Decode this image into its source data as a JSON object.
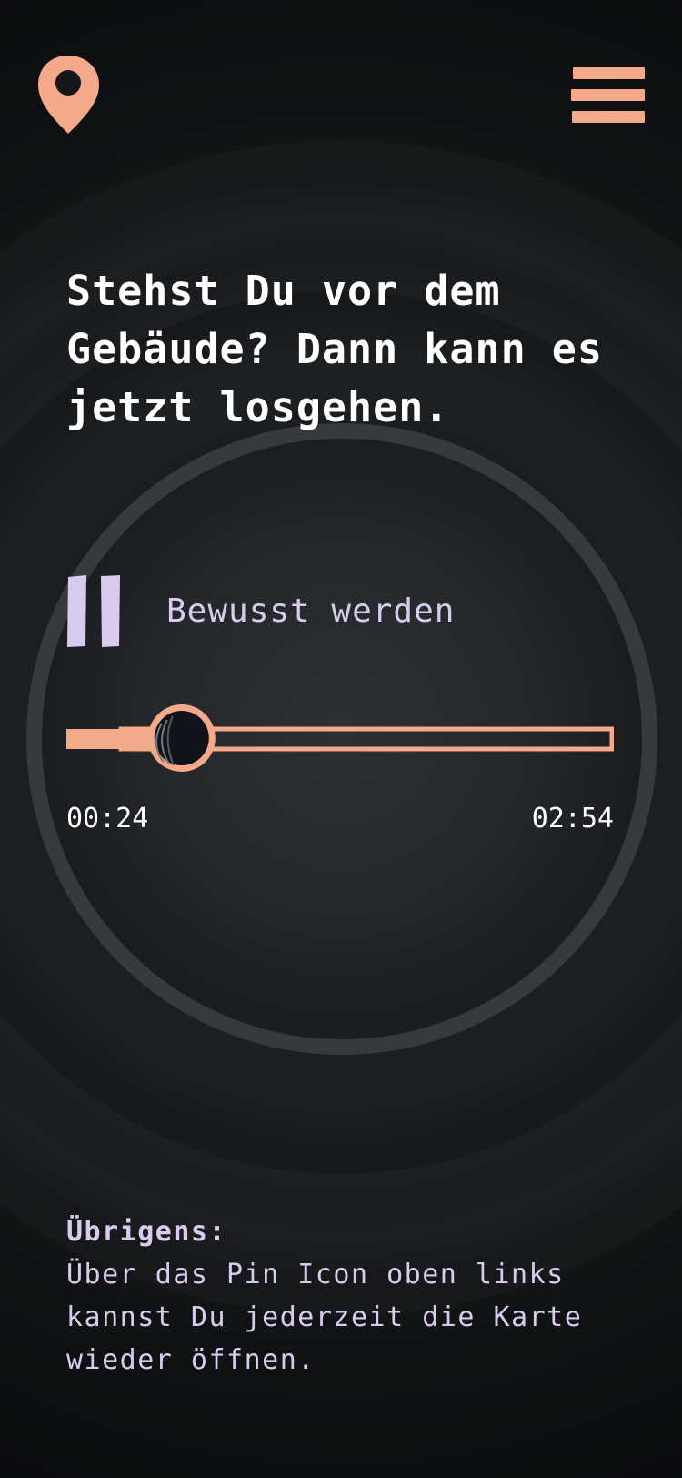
{
  "header": {
    "pin_icon": "map-pin-icon",
    "menu_icon": "hamburger-menu-icon"
  },
  "headline": "Stehst Du vor dem Gebäude? Dann kann es jetzt losgehen.",
  "player": {
    "play_state_icon": "pause-icon",
    "track_title": "Bewusst werden",
    "current_time": "00:24",
    "total_time": "02:54",
    "progress_fraction": 0.138
  },
  "note": {
    "title": "Übrigens:",
    "body": "Über das Pin Icon oben links kannst Du jederzeit die Karte wieder öffnen."
  },
  "colors": {
    "accent": "#f4a98b",
    "lavender": "#d9cbee",
    "background": "#111315",
    "ring": "#37393c",
    "knob_fill": "#111418"
  }
}
